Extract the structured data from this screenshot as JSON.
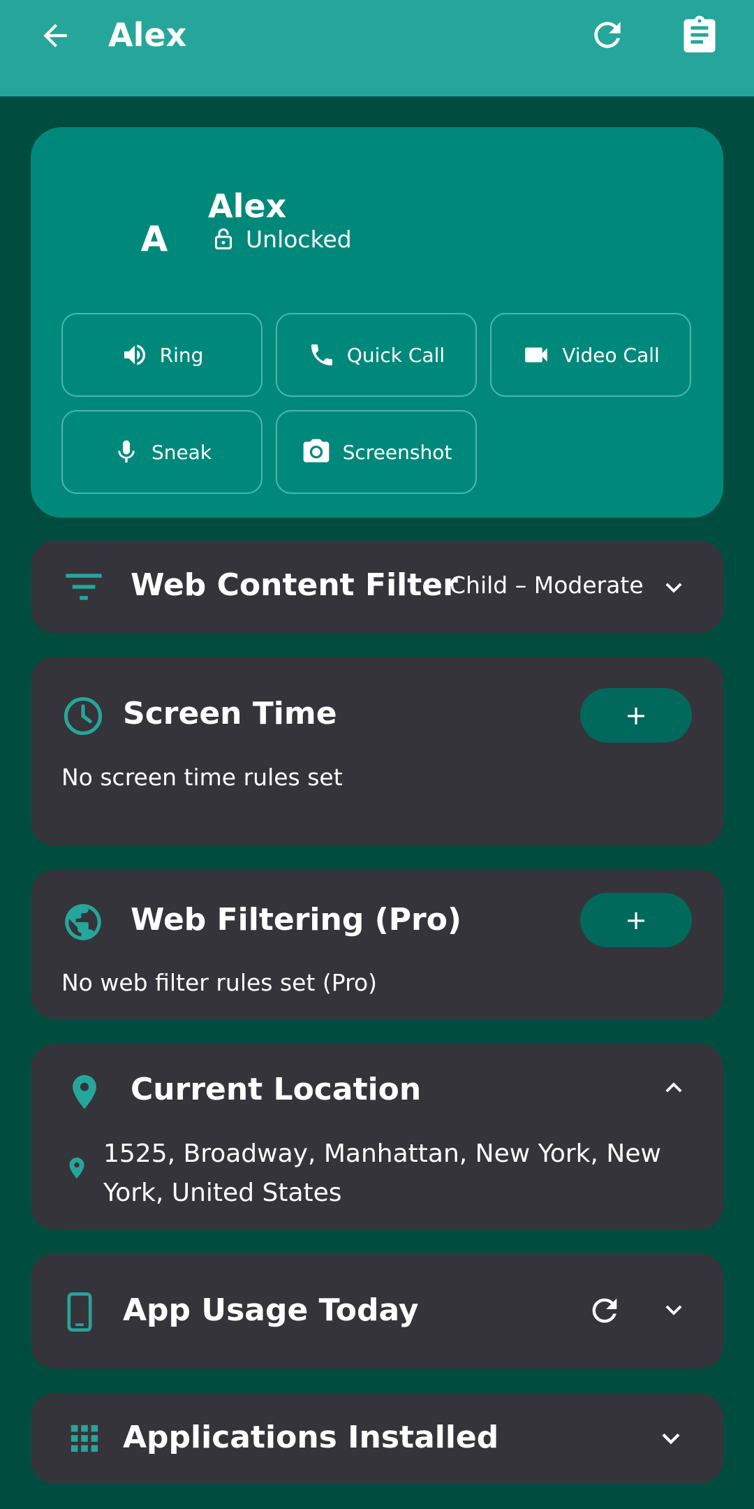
{
  "appbar": {
    "title": "Alex",
    "icons": {
      "back": "arrow-back-icon",
      "refresh": "refresh-icon",
      "clipboard": "clipboard-icon"
    }
  },
  "profile": {
    "avatar_letter": "A",
    "name": "Alex",
    "status": "Unlocked",
    "actions": [
      {
        "label": "Ring",
        "icon": "volume-icon"
      },
      {
        "label": "Quick Call",
        "icon": "phone-icon"
      },
      {
        "label": "Video Call",
        "icon": "video-camera-icon"
      },
      {
        "label": "Sneak",
        "icon": "microphone-icon"
      },
      {
        "label": "Screenshot",
        "icon": "camera-icon"
      }
    ]
  },
  "web_content_filter": {
    "title": "Web Content Filter",
    "value": "Child – Moderate"
  },
  "screen_time": {
    "title": "Screen Time",
    "add_label": "+",
    "empty": "No screen time rules set"
  },
  "web_filtering": {
    "title": "Web Filtering (Pro)",
    "add_label": "+",
    "empty": "No web filter rules set (Pro)"
  },
  "location": {
    "title": "Current Location",
    "address_line1": "1525, Broadway, Manhattan, New York, New",
    "address_line2": "York, United States"
  },
  "app_usage": {
    "title": "App Usage Today"
  },
  "apps_installed": {
    "title": "Applications Installed"
  },
  "colors": {
    "appbar": "#26a69a",
    "background": "#004d40",
    "profile_card": "#00897b",
    "dark_card": "#35343a",
    "pill": "#00695c",
    "accent": "#26a69a"
  }
}
